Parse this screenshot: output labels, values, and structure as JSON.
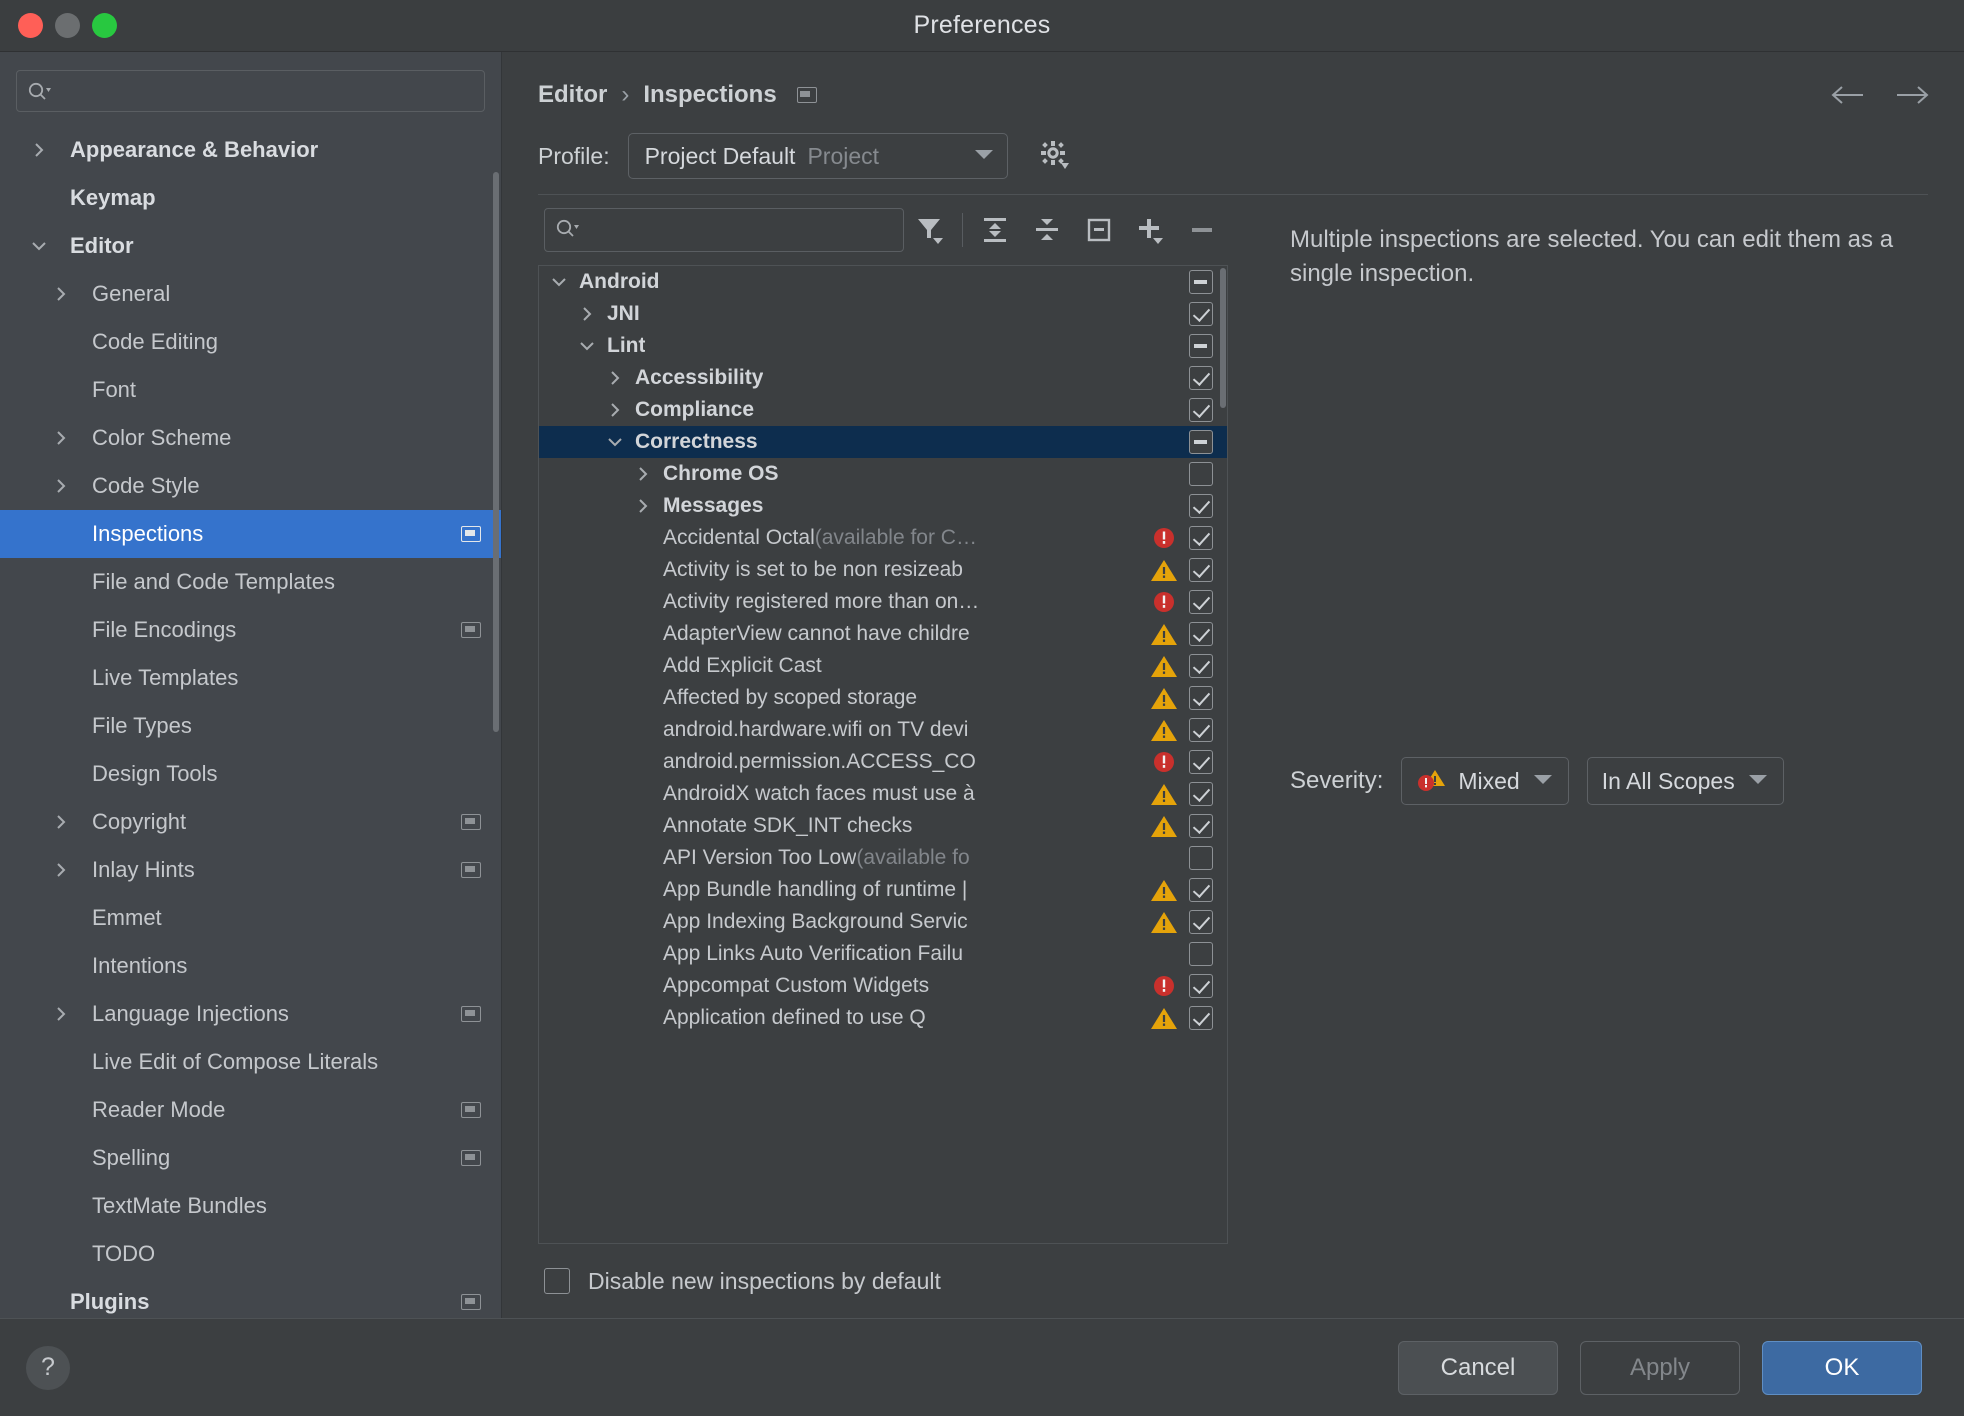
{
  "window": {
    "title": "Preferences"
  },
  "sidebar": {
    "search_placeholder": "",
    "search_value": "",
    "items": [
      {
        "label": "Appearance & Behavior",
        "arrow": "right",
        "bold": true,
        "selected": false,
        "badge": false
      },
      {
        "label": "Keymap",
        "arrow": "none",
        "bold": true,
        "selected": false,
        "badge": false
      },
      {
        "label": "Editor",
        "arrow": "down",
        "bold": true,
        "selected": false,
        "badge": false
      },
      {
        "label": "General",
        "arrow": "right",
        "bold": false,
        "selected": false,
        "badge": false,
        "indent": 1
      },
      {
        "label": "Code Editing",
        "arrow": "none",
        "bold": false,
        "selected": false,
        "badge": false,
        "indent": 1
      },
      {
        "label": "Font",
        "arrow": "none",
        "bold": false,
        "selected": false,
        "badge": false,
        "indent": 1
      },
      {
        "label": "Color Scheme",
        "arrow": "right",
        "bold": false,
        "selected": false,
        "badge": false,
        "indent": 1
      },
      {
        "label": "Code Style",
        "arrow": "right",
        "bold": false,
        "selected": false,
        "badge": false,
        "indent": 1
      },
      {
        "label": "Inspections",
        "arrow": "none",
        "bold": false,
        "selected": true,
        "badge": true,
        "indent": 1
      },
      {
        "label": "File and Code Templates",
        "arrow": "none",
        "bold": false,
        "selected": false,
        "badge": false,
        "indent": 1
      },
      {
        "label": "File Encodings",
        "arrow": "none",
        "bold": false,
        "selected": false,
        "badge": true,
        "indent": 1
      },
      {
        "label": "Live Templates",
        "arrow": "none",
        "bold": false,
        "selected": false,
        "badge": false,
        "indent": 1
      },
      {
        "label": "File Types",
        "arrow": "none",
        "bold": false,
        "selected": false,
        "badge": false,
        "indent": 1
      },
      {
        "label": "Design Tools",
        "arrow": "none",
        "bold": false,
        "selected": false,
        "badge": false,
        "indent": 1
      },
      {
        "label": "Copyright",
        "arrow": "right",
        "bold": false,
        "selected": false,
        "badge": true,
        "indent": 1
      },
      {
        "label": "Inlay Hints",
        "arrow": "right",
        "bold": false,
        "selected": false,
        "badge": true,
        "indent": 1
      },
      {
        "label": "Emmet",
        "arrow": "none",
        "bold": false,
        "selected": false,
        "badge": false,
        "indent": 1
      },
      {
        "label": "Intentions",
        "arrow": "none",
        "bold": false,
        "selected": false,
        "badge": false,
        "indent": 1
      },
      {
        "label": "Language Injections",
        "arrow": "right",
        "bold": false,
        "selected": false,
        "badge": true,
        "indent": 1
      },
      {
        "label": "Live Edit of Compose Literals",
        "arrow": "none",
        "bold": false,
        "selected": false,
        "badge": false,
        "indent": 1
      },
      {
        "label": "Reader Mode",
        "arrow": "none",
        "bold": false,
        "selected": false,
        "badge": true,
        "indent": 1
      },
      {
        "label": "Spelling",
        "arrow": "none",
        "bold": false,
        "selected": false,
        "badge": true,
        "indent": 1
      },
      {
        "label": "TextMate Bundles",
        "arrow": "none",
        "bold": false,
        "selected": false,
        "badge": false,
        "indent": 1
      },
      {
        "label": "TODO",
        "arrow": "none",
        "bold": false,
        "selected": false,
        "badge": false,
        "indent": 1
      },
      {
        "label": "Plugins",
        "arrow": "none",
        "bold": true,
        "selected": false,
        "badge": true
      }
    ]
  },
  "breadcrumb": {
    "root": "Editor",
    "separator": "›",
    "current": "Inspections"
  },
  "profile": {
    "label": "Profile:",
    "value": "Project Default",
    "scope": "Project"
  },
  "toolbar": {
    "search_value": "",
    "search_placeholder": "",
    "buttons": [
      {
        "name": "filter-icon",
        "tooltip": "Filter"
      },
      {
        "name": "expand-all-icon",
        "tooltip": "Expand All"
      },
      {
        "name": "collapse-all-icon",
        "tooltip": "Collapse All"
      },
      {
        "name": "reset-icon",
        "tooltip": "Reset"
      },
      {
        "name": "add-icon",
        "tooltip": "Add"
      },
      {
        "name": "remove-icon",
        "tooltip": "Remove"
      }
    ]
  },
  "tree": {
    "rows": [
      {
        "label": "Android",
        "indent": 0,
        "arrow": "down",
        "group": true,
        "check": "partial",
        "severity": "none",
        "selected": false
      },
      {
        "label": "JNI",
        "indent": 1,
        "arrow": "right",
        "group": true,
        "check": "checked",
        "severity": "none",
        "selected": false
      },
      {
        "label": "Lint",
        "indent": 1,
        "arrow": "down",
        "group": true,
        "check": "partial",
        "severity": "none",
        "selected": false
      },
      {
        "label": "Accessibility",
        "indent": 2,
        "arrow": "right",
        "group": true,
        "check": "checked",
        "severity": "none",
        "selected": false
      },
      {
        "label": "Compliance",
        "indent": 2,
        "arrow": "right",
        "group": true,
        "check": "checked",
        "severity": "none",
        "selected": false
      },
      {
        "label": "Correctness",
        "indent": 2,
        "arrow": "down",
        "group": true,
        "check": "partial",
        "severity": "none",
        "selected": true
      },
      {
        "label": "Chrome OS",
        "indent": 3,
        "arrow": "right",
        "group": true,
        "check": "empty",
        "severity": "none",
        "selected": false
      },
      {
        "label": "Messages",
        "indent": 3,
        "arrow": "right",
        "group": true,
        "check": "checked",
        "severity": "none",
        "selected": false
      },
      {
        "label": "Accidental Octal",
        "suffix": " (available for C…",
        "indent": 3,
        "arrow": "none",
        "group": false,
        "check": "checked",
        "severity": "error",
        "selected": false
      },
      {
        "label": "Activity is set to be non resizeab",
        "indent": 3,
        "arrow": "none",
        "group": false,
        "check": "checked",
        "severity": "warning",
        "selected": false
      },
      {
        "label": "Activity registered more than on…",
        "indent": 3,
        "arrow": "none",
        "group": false,
        "check": "checked",
        "severity": "error",
        "selected": false
      },
      {
        "label": "AdapterView cannot have childre",
        "indent": 3,
        "arrow": "none",
        "group": false,
        "check": "checked",
        "severity": "warning",
        "selected": false
      },
      {
        "label": "Add Explicit Cast",
        "indent": 3,
        "arrow": "none",
        "group": false,
        "check": "checked",
        "severity": "warning",
        "selected": false
      },
      {
        "label": "Affected by scoped storage",
        "indent": 3,
        "arrow": "none",
        "group": false,
        "check": "checked",
        "severity": "warning",
        "selected": false
      },
      {
        "label": "android.hardware.wifi on TV devi",
        "indent": 3,
        "arrow": "none",
        "group": false,
        "check": "checked",
        "severity": "warning",
        "selected": false
      },
      {
        "label": "android.permission.ACCESS_CO",
        "indent": 3,
        "arrow": "none",
        "group": false,
        "check": "checked",
        "severity": "error",
        "selected": false
      },
      {
        "label": "AndroidX watch faces must use à",
        "indent": 3,
        "arrow": "none",
        "group": false,
        "check": "checked",
        "severity": "warning",
        "selected": false
      },
      {
        "label": "Annotate SDK_INT checks",
        "indent": 3,
        "arrow": "none",
        "group": false,
        "check": "checked",
        "severity": "warning",
        "selected": false
      },
      {
        "label": "API Version Too Low",
        "suffix": " (available fo",
        "indent": 3,
        "arrow": "none",
        "group": false,
        "check": "empty",
        "severity": "none",
        "selected": false
      },
      {
        "label": "App Bundle handling of runtime |",
        "indent": 3,
        "arrow": "none",
        "group": false,
        "check": "checked",
        "severity": "warning",
        "selected": false
      },
      {
        "label": "App Indexing Background Servic",
        "indent": 3,
        "arrow": "none",
        "group": false,
        "check": "checked",
        "severity": "warning",
        "selected": false
      },
      {
        "label": "App Links Auto Verification Failu",
        "indent": 3,
        "arrow": "none",
        "group": false,
        "check": "empty",
        "severity": "none",
        "selected": false
      },
      {
        "label": "Appcompat Custom Widgets",
        "indent": 3,
        "arrow": "none",
        "group": false,
        "check": "checked",
        "severity": "error",
        "selected": false
      },
      {
        "label": "Application defined to use Q",
        "indent": 3,
        "arrow": "none",
        "group": false,
        "check": "checked",
        "severity": "warning",
        "selected": false
      }
    ]
  },
  "disable_new": {
    "label": "Disable new inspections by default",
    "checked": false
  },
  "detail": {
    "message": "Multiple inspections are selected. You can edit them as a single inspection.",
    "severity_label": "Severity:",
    "severity_value": "Mixed",
    "scope_value": "In All Scopes"
  },
  "footer": {
    "help": "?",
    "cancel": "Cancel",
    "apply": "Apply",
    "ok": "OK"
  },
  "colors": {
    "accent": "#3573cc",
    "selection": "#0d2d4e",
    "error": "#c9302c",
    "warning": "#e5a30a",
    "primary_button": "#3d6aa2"
  }
}
